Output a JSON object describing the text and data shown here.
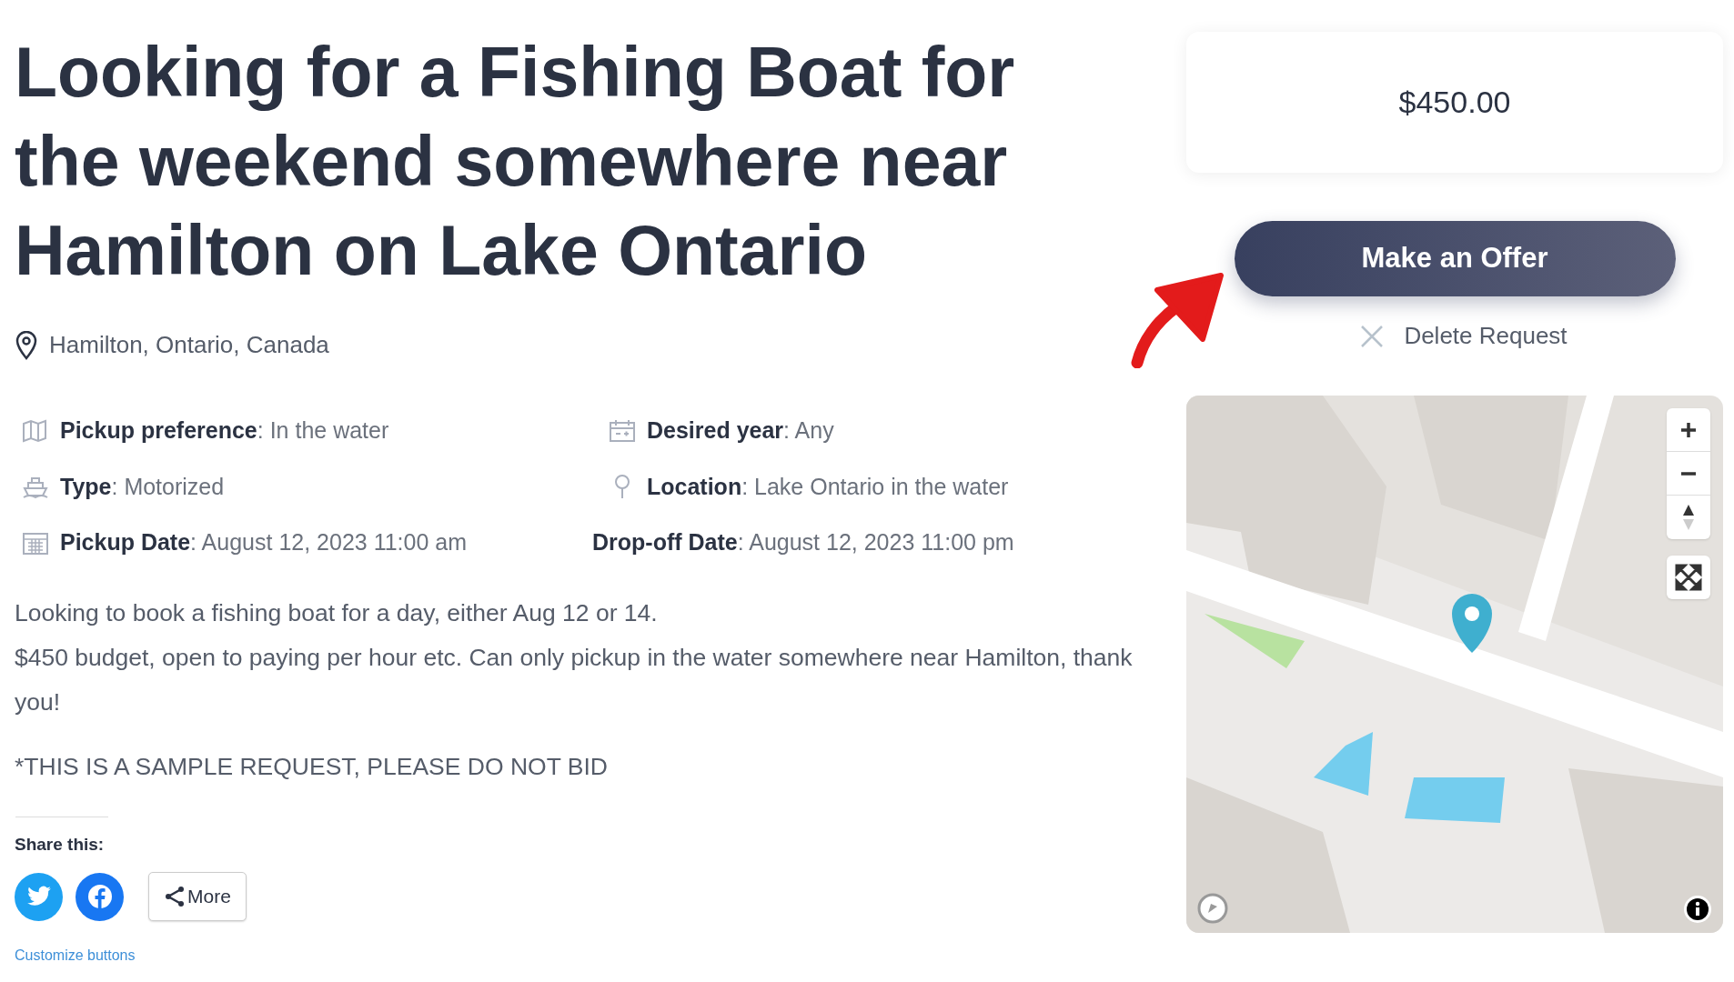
{
  "title": "Looking for a Fishing Boat for the weekend somewhere near Hamilton on Lake Ontario",
  "location": "Hamilton, Ontario, Canada",
  "details": [
    {
      "kind": "map",
      "text": "**Pickup preference**: In the water"
    },
    {
      "kind": "calendar-plus",
      "text": "**Desired year**: Any"
    },
    {
      "kind": "boat",
      "text": "**Type**: Motorized"
    },
    {
      "kind": "pin",
      "text": "**Location**: Lake Ontario in the water"
    },
    {
      "kind": "calendar",
      "text": "**Pickup Date**: August 12, 2023 11:00 am"
    },
    {
      "kind": "none",
      "text": "**Drop-off Date**: August 12, 2023 11:00 pm"
    }
  ],
  "description": [
    "Looking to book a fishing boat for a day, either Aug 12 or 14.",
    "$450 budget, open to paying per hour etc. Can only pickup in the water somewhere near Hamilton, thank you!",
    "*THIS IS A SAMPLE REQUEST, PLEASE DO NOT BID"
  ],
  "share": {
    "heading": "Share this:",
    "buttons": [
      {
        "kind": "twitter"
      },
      {
        "kind": "facebook"
      },
      {
        "kind": "more",
        "label": "More"
      }
    ],
    "customize_link": "Customize buttons"
  },
  "price": "$450.00",
  "offer_button": "Make an Offer",
  "delete_button": "Delete Request"
}
